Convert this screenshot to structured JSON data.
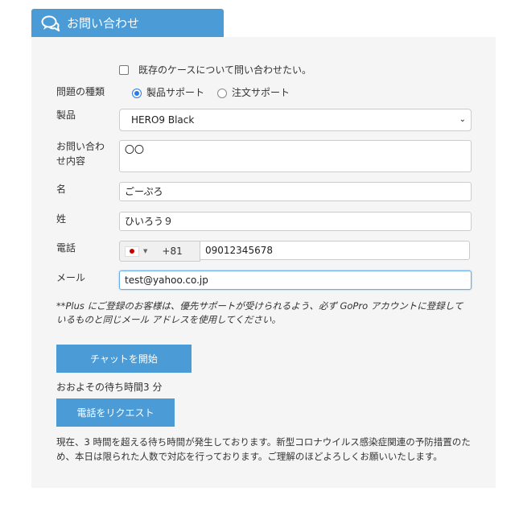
{
  "header": {
    "title": "お問い合わせ",
    "icon": "chat-bubbles-icon"
  },
  "form": {
    "existing_case_label": "既存のケースについて問い合わせたい。",
    "issue_type_label": "問題の種類",
    "issue_types": [
      "製品サポート",
      "注文サポート"
    ],
    "product_label": "製品",
    "product_value": "HERO9 Black",
    "inquiry_label": "お問い合わせ内容",
    "inquiry_value": "〇〇",
    "first_name_label": "名",
    "first_name_value": "ごーぷろ",
    "last_name_label": "姓",
    "last_name_value": "ひいろう９",
    "phone_label": "電話",
    "phone_code": "+81",
    "phone_value": "09012345678",
    "email_label": "メール",
    "email_value": "test@yahoo.co.jp",
    "note": "**Plus にご登録のお客様は、優先サポートが受けられるよう、必ず GoPro アカウントに登録しているものと同じメール アドレスを使用してください。",
    "chat_button": "チャットを開始",
    "wait_text": "おおよその待ち時間3 分",
    "phone_button": "電話をリクエスト",
    "notice": "現在、3 時間を超える待ち時間が発生しております。新型コロナウイルス感染症関連の予防措置のため、本日は限られた人数で対応を行っております。ご理解のほどよろしくお願いいたします。"
  },
  "colors": {
    "accent": "#4a9bd6",
    "panel": "#f5f5f5"
  }
}
